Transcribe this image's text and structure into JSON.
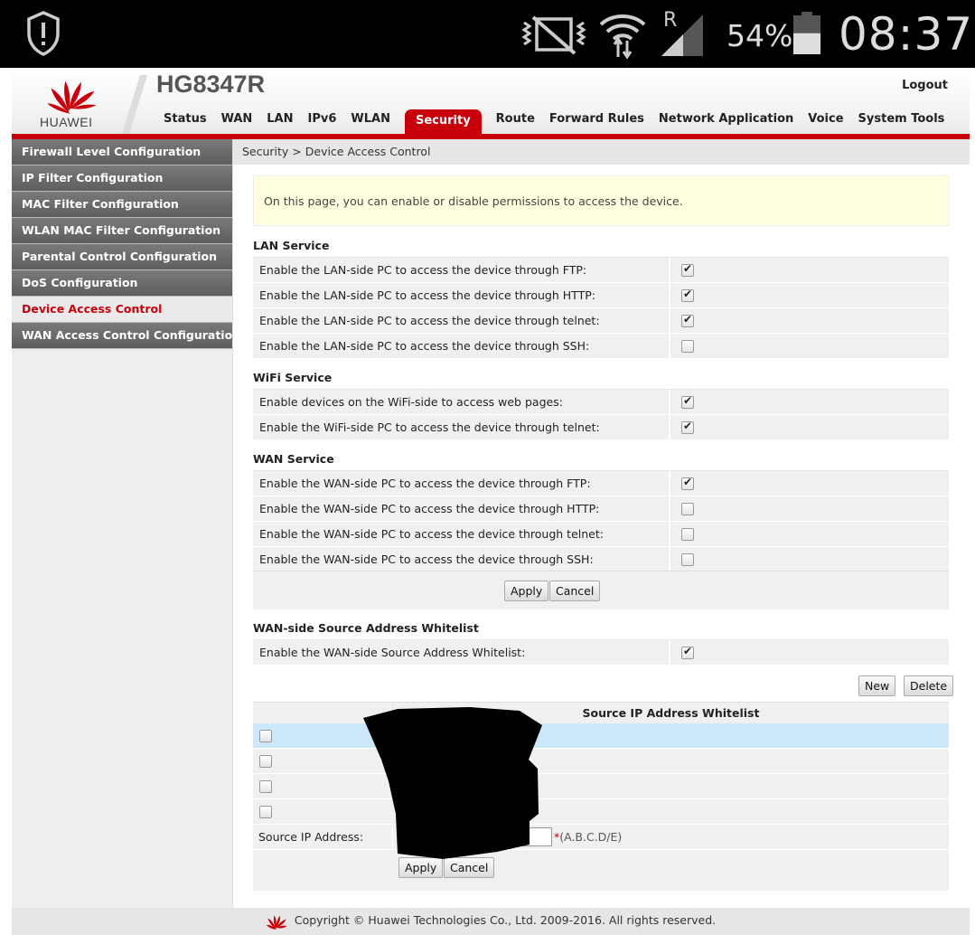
{
  "statusbar": {
    "battery_percent": "54%",
    "battery_level": 0.54,
    "time": "08:37",
    "roaming_indicator": "R",
    "icons": [
      "alert-shield-icon",
      "vibrate-off-icon",
      "wifi-icon",
      "cell-signal-icon",
      "battery-icon"
    ]
  },
  "header": {
    "brand": "HUAWEI",
    "model": "HG8347R",
    "logout": "Logout",
    "brand_color": "#c7000b"
  },
  "nav": {
    "tabs": [
      {
        "label": "Status"
      },
      {
        "label": "WAN"
      },
      {
        "label": "LAN"
      },
      {
        "label": "IPv6"
      },
      {
        "label": "WLAN"
      },
      {
        "label": "Security"
      },
      {
        "label": "Route"
      },
      {
        "label": "Forward Rules"
      },
      {
        "label": "Network Application"
      },
      {
        "label": "Voice"
      },
      {
        "label": "System Tools"
      }
    ],
    "active": "Security"
  },
  "sidebar": {
    "items": [
      {
        "label": "Firewall Level Configuration"
      },
      {
        "label": "IP Filter Configuration"
      },
      {
        "label": "MAC Filter Configuration"
      },
      {
        "label": "WLAN MAC Filter Configuration"
      },
      {
        "label": "Parental Control Configuration"
      },
      {
        "label": "DoS Configuration"
      },
      {
        "label": "Device Access Control"
      },
      {
        "label": "WAN Access Control Configuration"
      }
    ],
    "active": "Device Access Control"
  },
  "breadcrumb": "Security > Device Access Control",
  "notice": "On this page, you can enable or disable permissions to access the device.",
  "lan": {
    "title": "LAN Service",
    "rows": [
      {
        "label": "Enable the LAN-side PC to access the device through FTP:",
        "checked": true
      },
      {
        "label": "Enable the LAN-side PC to access the device through HTTP:",
        "checked": true
      },
      {
        "label": "Enable the LAN-side PC to access the device through telnet:",
        "checked": true
      },
      {
        "label": "Enable the LAN-side PC to access the device through SSH:",
        "checked": false
      }
    ]
  },
  "wifi": {
    "title": "WiFi Service",
    "rows": [
      {
        "label": "Enable devices on the WiFi-side to access web pages:",
        "checked": true
      },
      {
        "label": "Enable the WiFi-side PC to access the device through telnet:",
        "checked": true
      }
    ]
  },
  "wan": {
    "title": "WAN Service",
    "rows": [
      {
        "label": "Enable the WAN-side PC to access the device through FTP:",
        "checked": true
      },
      {
        "label": "Enable the WAN-side PC to access the device through HTTP:",
        "checked": false
      },
      {
        "label": "Enable the WAN-side PC to access the device through telnet:",
        "checked": false
      },
      {
        "label": "Enable the WAN-side PC to access the device through SSH:",
        "checked": false
      }
    ]
  },
  "buttons": {
    "apply": "Apply",
    "cancel": "Cancel",
    "new": "New",
    "delete": "Delete"
  },
  "whitelist": {
    "title": "WAN-side Source Address Whitelist",
    "enable_label": "Enable the WAN-side Source Address Whitelist:",
    "enable_checked": true,
    "column_header": "Source IP Address Whitelist",
    "rows": [
      {
        "checked": false,
        "selected": true
      },
      {
        "checked": false,
        "selected": false
      },
      {
        "checked": false,
        "selected": false
      },
      {
        "checked": false,
        "selected": false
      }
    ],
    "input_label": "Source IP Address:",
    "input_value": "",
    "required_mark": "*",
    "input_hint": "(A.B.C.D/E)"
  },
  "footer": {
    "copyright": "Copyright © Huawei Technologies Co., Ltd. 2009-2016. All rights reserved."
  }
}
